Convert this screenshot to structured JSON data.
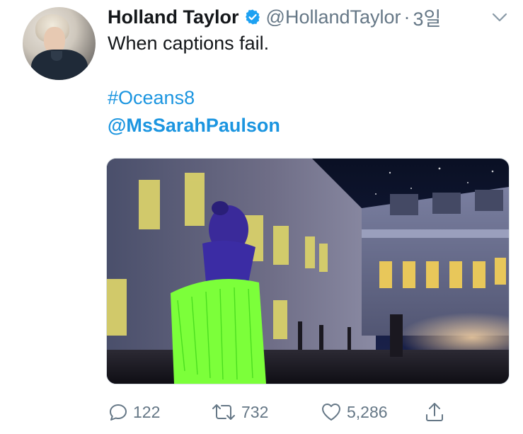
{
  "tweet": {
    "author_name": "Holland Taylor",
    "handle": "@HollandTaylor",
    "separator": "·",
    "time": "3일",
    "text": "When captions fail.",
    "hashtag": "#Oceans8",
    "mention": "@MsSarahPaulson",
    "colors": {
      "link": "#1b95e0",
      "verified": "#1da1f2",
      "muted": "#657786",
      "neon_green": "#7cff3a"
    }
  },
  "actions": {
    "reply_count": "122",
    "retweet_count": "732",
    "like_count": "5,286"
  }
}
